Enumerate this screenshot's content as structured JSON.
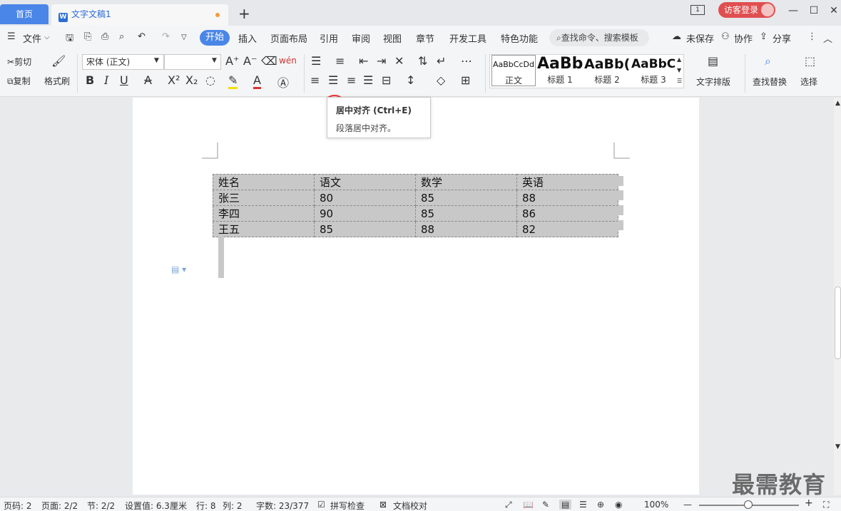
{
  "tabs": {
    "home": "首页",
    "doc": "文字文稿1",
    "add": "+"
  },
  "window": {
    "page_indicator": "1",
    "login": "访客登录",
    "minimize": "—",
    "maximize": "☐",
    "close": "✕"
  },
  "menu": {
    "file": "文件",
    "items": [
      "开始",
      "插入",
      "页面布局",
      "引用",
      "审阅",
      "视图",
      "章节",
      "开发工具",
      "特色功能"
    ],
    "search": "查找命令、搜索模板",
    "unsaved": "未保存",
    "collab": "协作",
    "share": "分享"
  },
  "toolbar": {
    "cut": "剪切",
    "copy": "复制",
    "format_painter": "格式刷",
    "font_name": "宋体 (正文)",
    "font_size": "",
    "bold": "B",
    "italic": "I",
    "underline": "U",
    "superscript": "X²",
    "subscript": "X₂",
    "text_layout": "文字排版",
    "find_replace": "查找替换",
    "select": "选择"
  },
  "styles": [
    {
      "sample": "AaBbCcDd",
      "label": "正文"
    },
    {
      "sample": "AaBb",
      "label": "标题 1"
    },
    {
      "sample": "AaBb(",
      "label": "标题 2"
    },
    {
      "sample": "AaBbC",
      "label": "标题 3"
    }
  ],
  "tooltip": {
    "title": "居中对齐 (Ctrl+E)",
    "desc": "段落居中对齐。"
  },
  "table": {
    "rows": [
      [
        "姓名",
        "语文",
        "数学",
        "英语"
      ],
      [
        "张三",
        "80",
        "85",
        "88"
      ],
      [
        "李四",
        "90",
        "85",
        "86"
      ],
      [
        "王五",
        "85",
        "88",
        "82"
      ]
    ]
  },
  "status": {
    "page_num": "页码: 2",
    "pages": "页面: 2/2",
    "section": "节: 2/2",
    "setting": "设置值: 6.3厘米",
    "line": "行: 8",
    "col": "列: 2",
    "words": "字数: 23/377",
    "spell": "拼写检查",
    "doc_check": "文档校对",
    "zoom": "100%"
  },
  "watermark": "最需教育"
}
